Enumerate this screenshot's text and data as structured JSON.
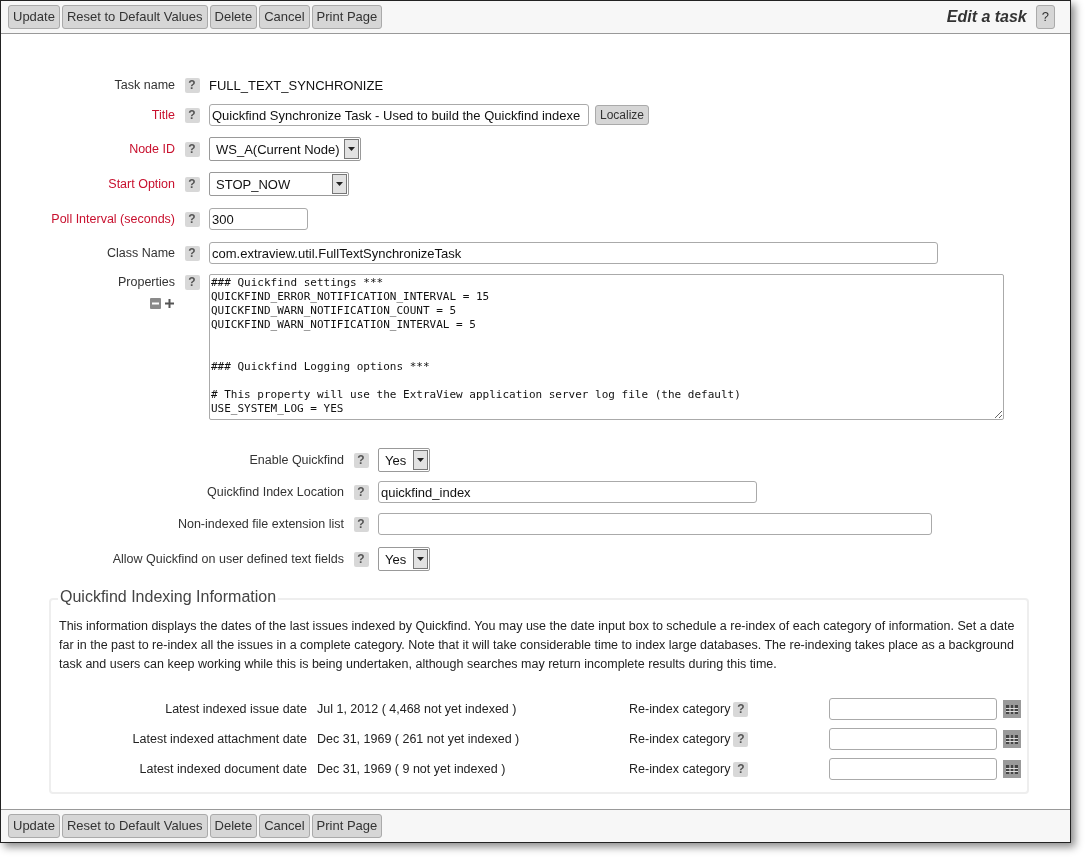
{
  "toolbar_top": {
    "buttons": [
      "Update",
      "Reset to Default Values",
      "Delete",
      "Cancel",
      "Print Page"
    ],
    "title": "Edit a task",
    "help": "?"
  },
  "fields": [
    {
      "kind": "static",
      "label": "Task name",
      "required": false,
      "help": "?",
      "value": "FULL_TEXT_SYNCHRONIZE"
    },
    {
      "kind": "input",
      "label": "Title",
      "required": true,
      "help": "?",
      "value": "Quickfind Synchronize Task - Used to build the Quickfind indexe",
      "button": "Localize"
    },
    {
      "kind": "select",
      "label": "Node ID",
      "required": true,
      "help": "?",
      "value": "WS_A(Current Node)"
    },
    {
      "kind": "select",
      "label": "Start Option",
      "required": true,
      "help": "?",
      "value": "STOP_NOW"
    },
    {
      "kind": "input",
      "label": "Poll Interval (seconds)",
      "required": true,
      "help": "?",
      "value": "300"
    },
    {
      "kind": "input",
      "label": "Class Name",
      "required": false,
      "help": "?",
      "value": "com.extraview.util.FullTextSynchronizeTask"
    },
    {
      "kind": "textarea",
      "label": "Properties",
      "required": false,
      "help": "?",
      "value": "### Quickfind settings ***\nQUICKFIND_ERROR_NOTIFICATION_INTERVAL = 15\nQUICKFIND_WARN_NOTIFICATION_COUNT = 5\nQUICKFIND_WARN_NOTIFICATION_INTERVAL = 5\n\n\n### Quickfind Logging options ***\n\n# This property will use the ExtraView application server log file (the default)\nUSE_SYSTEM_LOG = YES"
    }
  ],
  "quickfind_fields": [
    {
      "kind": "select",
      "label": "Enable Quickfind",
      "help": "?",
      "value": "Yes"
    },
    {
      "kind": "input",
      "label": "Quickfind Index Location",
      "help": "?",
      "value": "quickfind_index"
    },
    {
      "kind": "input",
      "label": "Non-indexed file extension list",
      "help": "?"
    },
    {
      "kind": "select",
      "label": "Allow Quickfind on user defined text fields",
      "help": "?",
      "value": "Yes"
    }
  ],
  "indexing_info": {
    "legend": "Quickfind Indexing Information",
    "description": "This information displays the dates of the last issues indexed by Quickfind. You may use the date input box to schedule a re-index of each category of information. Set a date far in the past to re-index all the issues in a complete category. Note that it will take considerable time to index large databases. The re-indexing takes place as a background task and users can keep working while this is being undertaken, although searches may return incomplete results during this time.",
    "rows": [
      {
        "label": "Latest indexed issue date",
        "value": "Jul 1, 2012 ( 4,468 not yet indexed )",
        "reindex_label": "Re-index category",
        "help": "?"
      },
      {
        "label": "Latest indexed attachment date",
        "value": "Dec 31, 1969 ( 261 not yet indexed )",
        "reindex_label": "Re-index category",
        "help": "?"
      },
      {
        "label": "Latest indexed document date",
        "value": "Dec 31, 1969 ( 9 not yet indexed )",
        "reindex_label": "Re-index category",
        "help": "?"
      }
    ]
  },
  "toolbar_bottom": {
    "buttons": [
      "Update",
      "Reset to Default Values",
      "Delete",
      "Cancel",
      "Print Page"
    ]
  }
}
